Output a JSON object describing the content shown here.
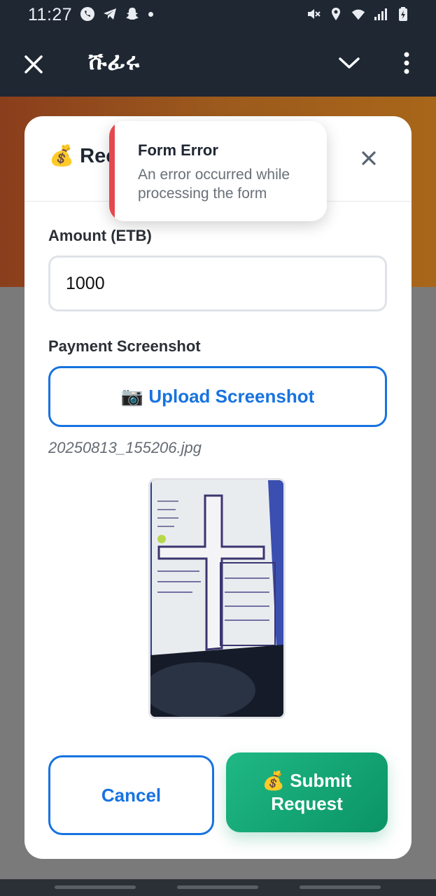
{
  "status_bar": {
    "time": "11:27",
    "left_icons": [
      "whatsapp-icon",
      "telegram-icon",
      "snapchat-icon",
      "dot-indicator"
    ],
    "right_icons": [
      "mute-icon",
      "location-icon",
      "wifi-icon",
      "cell-signal-icon",
      "battery-icon"
    ]
  },
  "app_bar": {
    "title": "ሹፊሩ",
    "close_icon": "close-icon",
    "collapse_icon": "chevron-down-icon",
    "menu_icon": "more-vert-icon"
  },
  "modal": {
    "title": "💰 Rec",
    "close_symbol": "×",
    "amount_label": "Amount (ETB)",
    "amount_value": "1000",
    "screenshot_label": "Payment Screenshot",
    "upload_label": "📷 Upload Screenshot",
    "filename": "20250813_155206.jpg",
    "cancel_label": "Cancel",
    "submit_label": "💰 Submit Request"
  },
  "toast": {
    "title": "Form Error",
    "message": "An error occurred while processing the form",
    "accent_color": "#e5484d"
  },
  "colors": {
    "primary": "#1773e0",
    "success": "#12a572",
    "header_bg": "#1f2733"
  }
}
